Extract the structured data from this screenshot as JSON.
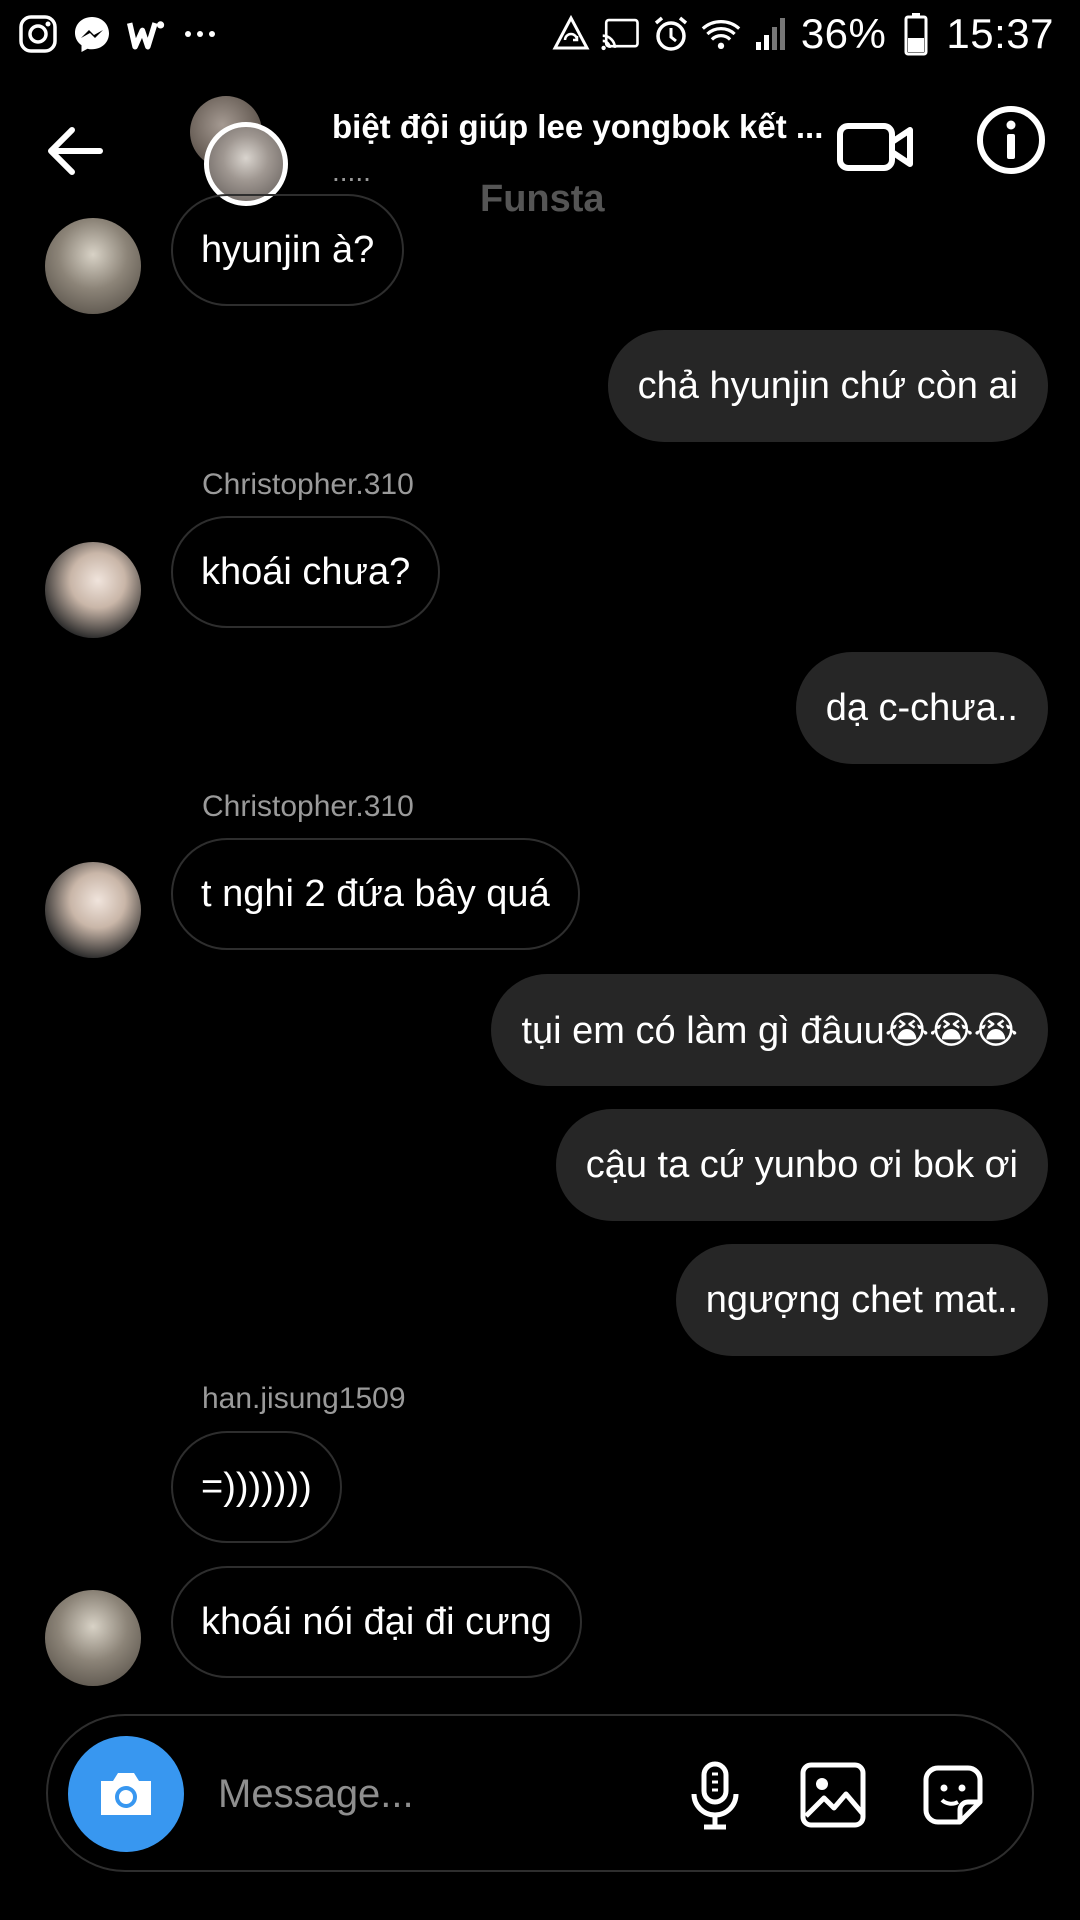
{
  "status_bar": {
    "battery": "36%",
    "time": "15:37",
    "left_icons": [
      "instagram-icon",
      "messenger-icon",
      "w-app-icon",
      "more-icon"
    ],
    "right_icons": [
      "sync-icon",
      "cast-icon",
      "alarm-icon",
      "wifi-icon",
      "signal-icon",
      "battery-icon"
    ]
  },
  "header": {
    "title": "biệt đội giúp lee yongbok kết ...",
    "subtitle": ".....",
    "watermark": "Funsta"
  },
  "messages": [
    {
      "type": "in",
      "text": "hyunjin à?"
    },
    {
      "type": "out",
      "text": "chả hyunjin chứ còn ai"
    },
    {
      "type": "in",
      "sender": "Christopher.310",
      "text": "khoái chưa?"
    },
    {
      "type": "out",
      "text": "dạ c-chưa.."
    },
    {
      "type": "in",
      "sender": "Christopher.310",
      "text": "t nghi 2 đứa bây quá"
    },
    {
      "type": "out",
      "text": "tụi em có làm gì đâuu😭😭😭"
    },
    {
      "type": "out",
      "text": "cậu ta cứ yunbo ơi bok ơi"
    },
    {
      "type": "out",
      "text": "ngượng chet mat.."
    },
    {
      "type": "in",
      "sender": "han.jisung1509",
      "text": "=)))))))"
    },
    {
      "type": "in",
      "text": "khoái nói đại đi cưng"
    }
  ],
  "composer": {
    "placeholder": "Message..."
  },
  "colors": {
    "background": "#000000",
    "bubble_out": "#262626",
    "bubble_in_border": "#2e2e2e",
    "camera_button": "#3897f0"
  }
}
